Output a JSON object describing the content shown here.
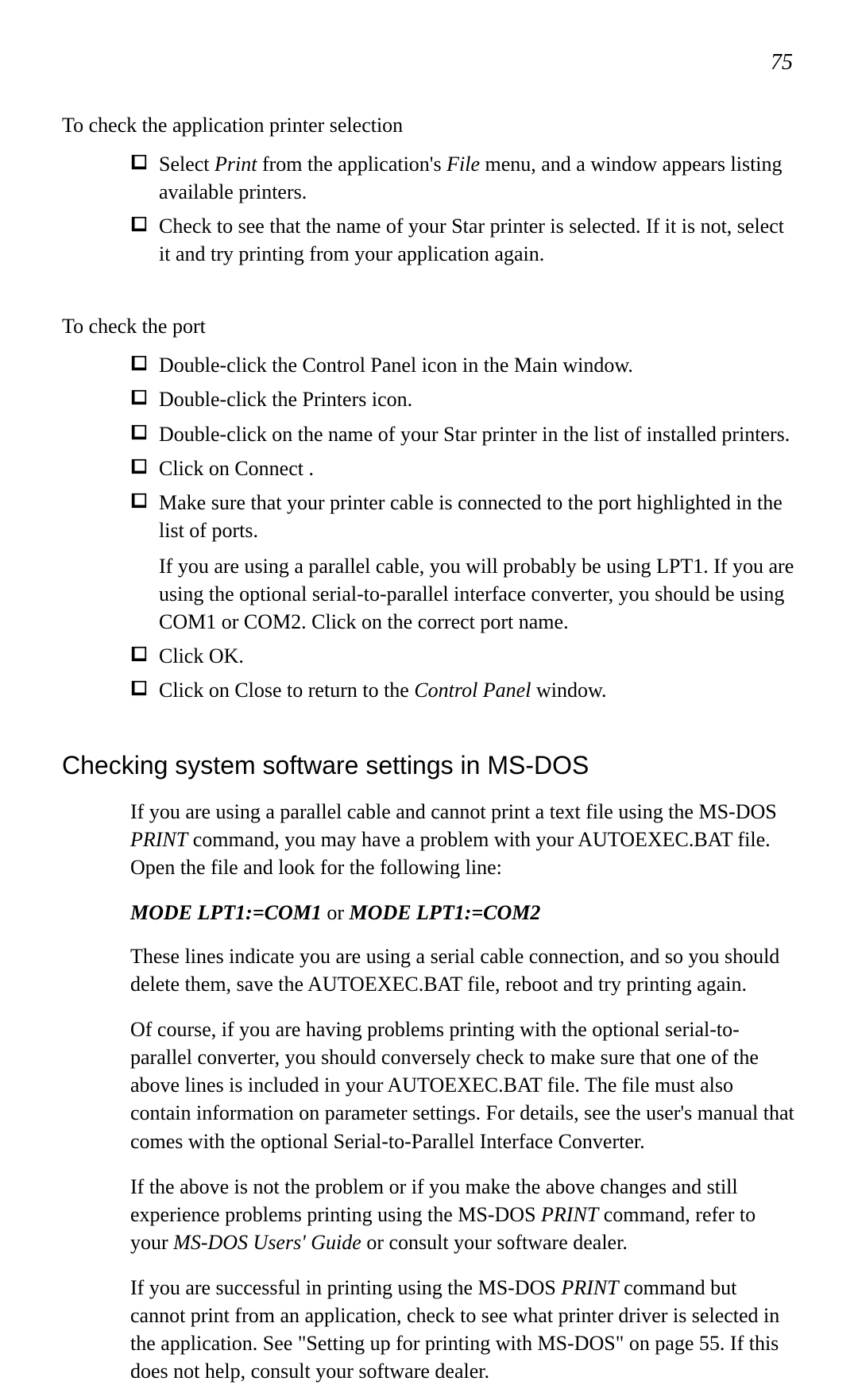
{
  "page_number": "75",
  "section1": {
    "intro": "To check the application printer selection",
    "items": [
      {
        "before": "Select ",
        "em1": "Print",
        "mid": " from the application's ",
        "em2": "File",
        "after": " menu, and a window appears listing available printers."
      },
      {
        "text": "Check to see that the name of your Star printer is selected. If it is not, select it and try printing from your application again."
      }
    ]
  },
  "section2": {
    "intro": "To check the port",
    "items": [
      {
        "text": "Double-click the Control Panel    icon in the Main window."
      },
      {
        "text": "Double-click the Printers   icon."
      },
      {
        "text": "Double-click on the name of your Star printer in the list of installed printers."
      },
      {
        "text": "Click on Connect  ."
      },
      {
        "text": "Make sure that your printer cable is connected to the port highlighted in the list of ports.",
        "extra": "If you are using a parallel cable, you will probably be using LPT1. If you are using the optional serial-to-parallel interface converter, you should be using COM1 or COM2. Click on the correct port name."
      },
      {
        "text": "Click OK."
      },
      {
        "before": "Click on Close   to return to the ",
        "em1": "Control Panel",
        "after": "  window."
      }
    ]
  },
  "section3": {
    "heading": "Checking system software settings in MS-DOS",
    "para1_before": "If you are using a parallel cable and cannot print a text file using the MS-DOS ",
    "para1_em": "PRINT",
    "para1_after": "  command, you may have a problem with your AUTOEXEC.BAT file. Open the file and look for the following line:",
    "mode1": "MODE LPT1:=COM1",
    "mode_or": " or ",
    "mode2": "MODE LPT1:=COM2",
    "para2": "These lines indicate you are using a serial cable connection, and so you should delete them, save the AUTOEXEC.BAT file, reboot and try printing again.",
    "para3": "Of course, if you are having problems printing with the optional serial-to-parallel converter, you should conversely check to make sure that one of the above lines is included in your AUTOEXEC.BAT file. The file must also contain information on parameter settings. For details, see the user's manual that comes with the optional Serial-to-Parallel Interface Converter.",
    "para4_before": "If the above is not the problem or if you make the above changes and still experience problems printing using the MS-DOS ",
    "para4_em1": "PRINT",
    "para4_mid": "  command, refer to your ",
    "para4_em2": "MS-DOS Users' Guide",
    "para4_after": " or consult your software dealer.",
    "para5_before": "If you are successful in printing using the MS-DOS ",
    "para5_em": "PRINT",
    "para5_after": "  command but cannot print from an application, check to see what printer driver is selected in the application. See \"Setting up for printing with MS-DOS\" on page 55. If this does not help, consult your software dealer."
  }
}
